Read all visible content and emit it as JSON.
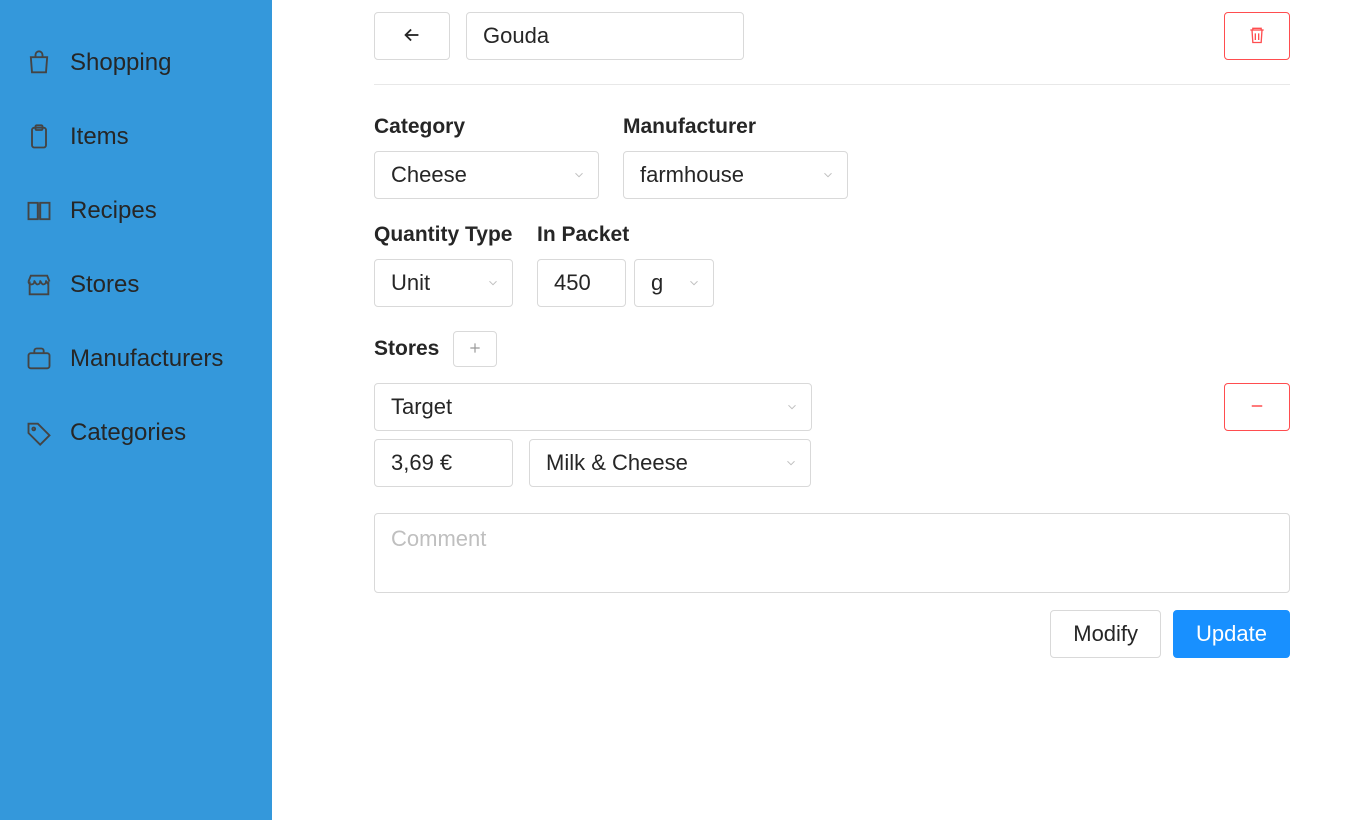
{
  "sidebar": {
    "items": [
      {
        "label": "Shopping"
      },
      {
        "label": "Items"
      },
      {
        "label": "Recipes"
      },
      {
        "label": "Stores"
      },
      {
        "label": "Manufacturers"
      },
      {
        "label": "Categories"
      }
    ]
  },
  "header": {
    "name": "Gouda"
  },
  "form": {
    "category_label": "Category",
    "category_value": "Cheese",
    "manufacturer_label": "Manufacturer",
    "manufacturer_value": "farmhouse",
    "quantity_type_label": "Quantity Type",
    "quantity_type_value": "Unit",
    "in_packet_label": "In Packet",
    "in_packet_value": "450",
    "in_packet_unit": "g",
    "stores_label": "Stores",
    "stores": [
      {
        "store": "Target",
        "price": "3,69 €",
        "section": "Milk & Cheese"
      }
    ],
    "comment_placeholder": "Comment",
    "comment_value": ""
  },
  "actions": {
    "modify": "Modify",
    "update": "Update"
  }
}
